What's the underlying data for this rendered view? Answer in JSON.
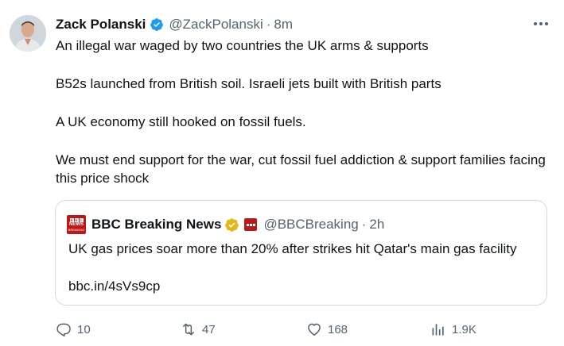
{
  "author": {
    "name": "Zack Polanski",
    "handle": "@ZackPolanski",
    "separator": "·",
    "time": "8m"
  },
  "tweet": {
    "paragraphs": [
      "An illegal war waged by two countries the UK arms & supports",
      "B52s launched from British soil. Israeli jets built with British parts",
      "A UK economy still hooked on fossil fuels.",
      "We must end support for the war, cut fossil fuel addiction & support families facing this price shock"
    ]
  },
  "quote": {
    "name": "BBC Breaking News",
    "handle": "@BBCBreaking",
    "separator": "·",
    "time": "2h",
    "text": "UK gas prices soar more than 20% after strikes hit Qatar's main gas facility",
    "link": "bbc.in/4sVs9cp",
    "logo_top": "NEWS",
    "logo_bottom": "BREAKING"
  },
  "actions": {
    "replies": "10",
    "reposts": "47",
    "likes": "168",
    "views": "1.9K"
  },
  "colors": {
    "text": "#0f1419",
    "secondary": "#536471",
    "verified_blue": "#1d9bf0",
    "verified_gold": "#e2b719",
    "bbc_red": "#bb1919",
    "border": "#cfd9de"
  },
  "icons": [
    "verified-badge-icon",
    "more-icon",
    "reply-icon",
    "repost-icon",
    "like-icon",
    "views-icon"
  ]
}
